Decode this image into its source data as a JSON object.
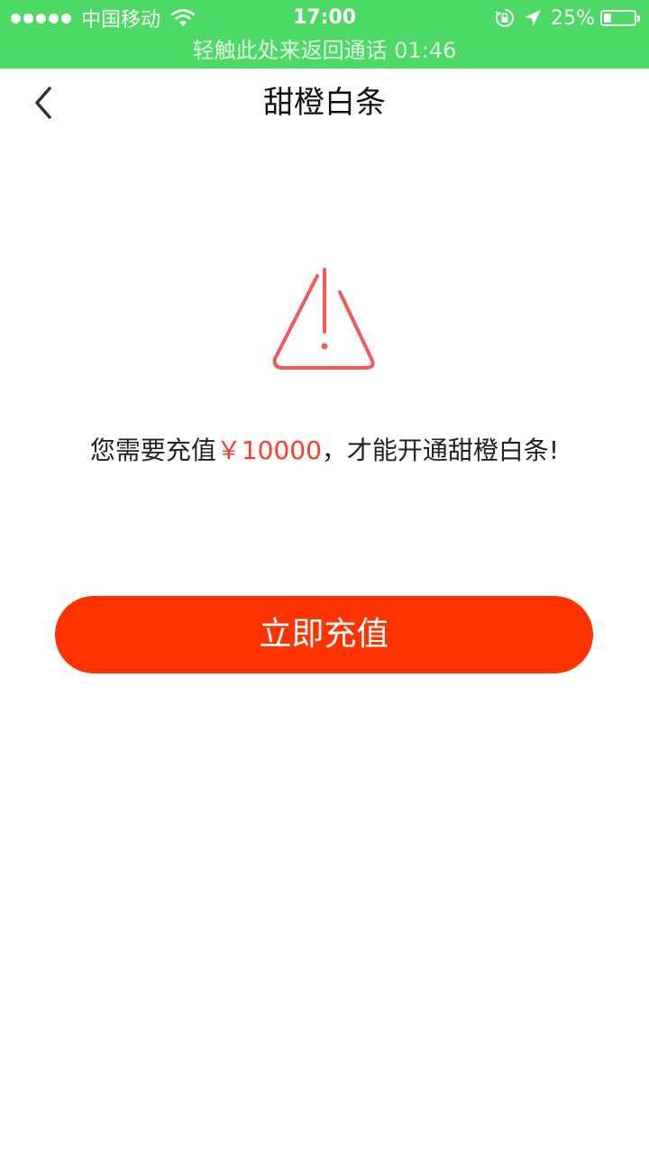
{
  "status_bar": {
    "carrier": "中国移动",
    "time": "17:00",
    "battery_percent_label": "25%",
    "battery_level": 0.25,
    "call_banner": "轻触此处来返回通话 01:46",
    "background_color": "#4cd964",
    "icons": [
      "signal-dots-icon",
      "wifi-icon",
      "orientation-lock-icon",
      "location-arrow-icon",
      "battery-icon"
    ]
  },
  "nav": {
    "back_icon": "chevron-left-icon",
    "title": "甜橙白条"
  },
  "main": {
    "warning_icon": "warning-triangle-icon",
    "warning_color": "#f05a5a",
    "message_prefix": "您需要充值",
    "message_amount": "￥10000",
    "message_suffix": "，才能开通甜橙白条!",
    "amount_color": "#ff3b30"
  },
  "action": {
    "recharge_label": "立即充值",
    "button_color": "#ff3300"
  }
}
